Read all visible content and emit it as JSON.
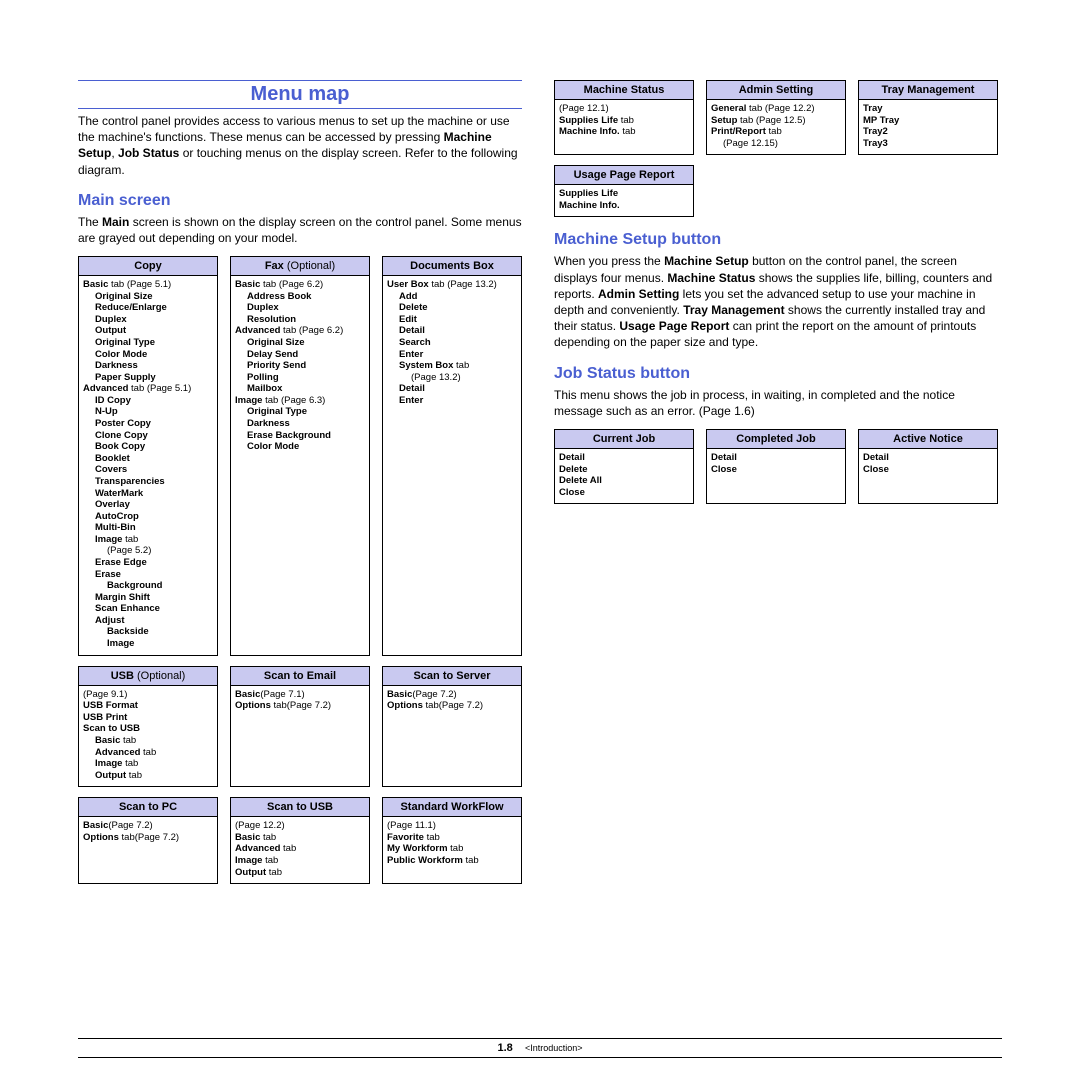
{
  "title": "Menu map",
  "intro": "The control panel provides access to various menus to set up the machine or use the machine's functions. These menus can be accessed by pressing Machine Setup, Job Status or touching menus on the display screen. Refer to the following diagram.",
  "main_screen_h": "Main screen",
  "main_screen_p": "The Main screen is shown on the display screen on the control panel. Some menus are grayed out depending on your model.",
  "machine_setup_h": "Machine Setup button",
  "machine_setup_p": "When you press the Machine Setup button on the control panel, the screen displays four menus. Machine Status shows the supplies life, billing, counters and reports. Admin Setting lets you set the advanced setup to use your machine in depth and conveniently. Tray Management shows the currently installed tray and their status. Usage Page Report can print the report on the amount of printouts depending on the paper size and type.",
  "job_status_h": "Job Status button",
  "job_status_p": "This menu shows the job in process, in waiting, in completed and the notice message such as an error. (Page 1.6)",
  "footer_page": "1.8",
  "footer_section": "<Introduction>",
  "left_row1": {
    "copy": {
      "title": "Copy",
      "lines": [
        {
          "t": "Basic",
          "b": 1,
          "a": " tab (Page 5.1)"
        },
        {
          "t": "Original Size",
          "b": 1,
          "ind": 1
        },
        {
          "t": "Reduce/Enlarge",
          "b": 1,
          "ind": 1
        },
        {
          "t": "Duplex",
          "b": 1,
          "ind": 1
        },
        {
          "t": "Output",
          "b": 1,
          "ind": 1
        },
        {
          "t": "Original Type",
          "b": 1,
          "ind": 1
        },
        {
          "t": "Color Mode",
          "b": 1,
          "ind": 1
        },
        {
          "t": "Darkness",
          "b": 1,
          "ind": 1
        },
        {
          "t": "Paper Supply",
          "b": 1,
          "ind": 1
        },
        {
          "t": "Advanced",
          "b": 1,
          "a": " tab (Page 5.1)"
        },
        {
          "t": "ID Copy",
          "b": 1,
          "ind": 1
        },
        {
          "t": "N-Up",
          "b": 1,
          "ind": 1
        },
        {
          "t": "Poster Copy",
          "b": 1,
          "ind": 1
        },
        {
          "t": "Clone Copy",
          "b": 1,
          "ind": 1
        },
        {
          "t": "Book Copy",
          "b": 1,
          "ind": 1
        },
        {
          "t": "Booklet",
          "b": 1,
          "ind": 1
        },
        {
          "t": "Covers",
          "b": 1,
          "ind": 1
        },
        {
          "t": "Transparencies",
          "b": 1,
          "ind": 1
        },
        {
          "t": "WaterMark",
          "b": 1,
          "ind": 1
        },
        {
          "t": "Overlay",
          "b": 1,
          "ind": 1
        },
        {
          "t": "AutoCrop",
          "b": 1,
          "ind": 1
        },
        {
          "t": "Multi-Bin",
          "b": 1,
          "ind": 1
        },
        {
          "t": "Image",
          "b": 1,
          "ind": 1,
          "a": " tab"
        },
        {
          "t": "(Page 5.2)",
          "b": 0,
          "ind": 2
        },
        {
          "t": "Erase Edge",
          "b": 1,
          "ind": 1
        },
        {
          "t": "Erase",
          "b": 1,
          "ind": 1
        },
        {
          "t": "Background",
          "b": 1,
          "ind": 2
        },
        {
          "t": "Margin Shift",
          "b": 1,
          "ind": 1
        },
        {
          "t": "Scan Enhance",
          "b": 1,
          "ind": 1
        },
        {
          "t": "Adjust",
          "b": 1,
          "ind": 1
        },
        {
          "t": "Backside",
          "b": 1,
          "ind": 2
        },
        {
          "t": "Image",
          "b": 1,
          "ind": 2
        }
      ]
    },
    "fax": {
      "title": "Fax",
      "opt": " (Optional)",
      "lines": [
        {
          "t": "Basic",
          "b": 1,
          "a": " tab (Page 6.2)"
        },
        {
          "t": "Address Book",
          "b": 1,
          "ind": 1
        },
        {
          "t": "Duplex",
          "b": 1,
          "ind": 1
        },
        {
          "t": "Resolution",
          "b": 1,
          "ind": 1
        },
        {
          "t": "Advanced",
          "b": 1,
          "a": " tab (Page 6.2)"
        },
        {
          "t": "Original Size",
          "b": 1,
          "ind": 1
        },
        {
          "t": "Delay Send",
          "b": 1,
          "ind": 1
        },
        {
          "t": "Priority Send",
          "b": 1,
          "ind": 1
        },
        {
          "t": "Polling",
          "b": 1,
          "ind": 1
        },
        {
          "t": "Mailbox",
          "b": 1,
          "ind": 1
        },
        {
          "t": "Image",
          "b": 1,
          "a": " tab (Page 6.3)"
        },
        {
          "t": "Original Type",
          "b": 1,
          "ind": 1
        },
        {
          "t": "Darkness",
          "b": 1,
          "ind": 1
        },
        {
          "t": "Erase Background",
          "b": 1,
          "ind": 1
        },
        {
          "t": "Color Mode",
          "b": 1,
          "ind": 1
        }
      ]
    },
    "docbox": {
      "title": "Documents Box",
      "lines": [
        {
          "t": "User Box",
          "b": 1,
          "a": " tab (Page 13.2)"
        },
        {
          "t": "Add",
          "b": 1,
          "ind": 1
        },
        {
          "t": "Delete",
          "b": 1,
          "ind": 1
        },
        {
          "t": "Edit",
          "b": 1,
          "ind": 1
        },
        {
          "t": "Detail",
          "b": 1,
          "ind": 1
        },
        {
          "t": "Search",
          "b": 1,
          "ind": 1
        },
        {
          "t": "Enter",
          "b": 1,
          "ind": 1
        },
        {
          "t": "System Box",
          "b": 1,
          "ind": 1,
          "a": " tab"
        },
        {
          "t": "(Page 13.2)",
          "b": 0,
          "ind": 2
        },
        {
          "t": "Detail",
          "b": 1,
          "ind": 1
        },
        {
          "t": "Enter",
          "b": 1,
          "ind": 1
        }
      ]
    }
  },
  "left_row2": {
    "usb": {
      "title": "USB",
      "opt": " (Optional)",
      "lines": [
        {
          "t": "(Page 9.1)",
          "b": 0
        },
        {
          "t": "USB Format",
          "b": 1
        },
        {
          "t": "USB Print",
          "b": 1
        },
        {
          "t": "Scan to USB",
          "b": 1
        },
        {
          "t": "Basic",
          "b": 1,
          "ind": 1,
          "a": " tab"
        },
        {
          "t": "Advanced",
          "b": 1,
          "ind": 1,
          "a": " tab"
        },
        {
          "t": "Image",
          "b": 1,
          "ind": 1,
          "a": " tab"
        },
        {
          "t": "Output",
          "b": 1,
          "ind": 1,
          "a": " tab"
        }
      ]
    },
    "scan_email": {
      "title": "Scan to Email",
      "lines": [
        {
          "t": "Basic",
          "b": 1,
          "a": "(Page 7.1)"
        },
        {
          "t": "Options",
          "b": 1,
          "a": " tab(Page 7.2)"
        }
      ]
    },
    "scan_server": {
      "title": "Scan to Server",
      "lines": [
        {
          "t": "Basic",
          "b": 1,
          "a": "(Page 7.2)"
        },
        {
          "t": "Options",
          "b": 1,
          "a": " tab(Page 7.2)"
        }
      ]
    }
  },
  "left_row3": {
    "scan_pc": {
      "title": "Scan to PC",
      "lines": [
        {
          "t": "Basic",
          "b": 1,
          "a": "(Page 7.2)"
        },
        {
          "t": "Options",
          "b": 1,
          "a": " tab(Page 7.2)"
        }
      ]
    },
    "scan_usb": {
      "title": "Scan to USB",
      "lines": [
        {
          "t": "(Page 12.2)",
          "b": 0
        },
        {
          "t": "Basic",
          "b": 1,
          "a": " tab"
        },
        {
          "t": "Advanced",
          "b": 1,
          "a": " tab"
        },
        {
          "t": "Image",
          "b": 1,
          "a": " tab"
        },
        {
          "t": "Output",
          "b": 1,
          "a": " tab"
        }
      ]
    },
    "workflow": {
      "title": "Standard WorkFlow",
      "lines": [
        {
          "t": "(Page 11.1)",
          "b": 0
        },
        {
          "t": "Favorite",
          "b": 1,
          "a": " tab"
        },
        {
          "t": "My Workform",
          "b": 1,
          "a": " tab"
        },
        {
          "t": "Public Workform",
          "b": 1,
          "a": " tab"
        }
      ]
    }
  },
  "right_row1": {
    "machine_status": {
      "title": "Machine Status",
      "lines": [
        {
          "t": "(Page 12.1)",
          "b": 0
        },
        {
          "t": "Supplies Life",
          "b": 1,
          "a": " tab"
        },
        {
          "t": "Machine Info.",
          "b": 1,
          "a": " tab"
        }
      ]
    },
    "admin_setting": {
      "title": "Admin Setting",
      "lines": [
        {
          "t": "General",
          "b": 1,
          "a": " tab (Page 12.2)"
        },
        {
          "t": "Setup",
          "b": 1,
          "a": " tab (Page 12.5)"
        },
        {
          "t": "Print/Report",
          "b": 1,
          "a": " tab"
        },
        {
          "t": "(Page 12.15)",
          "b": 0,
          "ind": 1
        }
      ]
    },
    "tray_mgmt": {
      "title": "Tray Management",
      "lines": [
        {
          "t": "Tray",
          "b": 1
        },
        {
          "t": "MP Tray",
          "b": 1
        },
        {
          "t": "Tray2",
          "b": 1
        },
        {
          "t": "Tray3",
          "b": 1
        }
      ]
    }
  },
  "right_row1b": {
    "usage_report": {
      "title": "Usage Page Report",
      "lines": [
        {
          "t": "Supplies Life",
          "b": 1
        },
        {
          "t": "Machine Info.",
          "b": 1
        }
      ]
    }
  },
  "right_row2": {
    "current_job": {
      "title": "Current Job",
      "lines": [
        {
          "t": "Detail",
          "b": 1
        },
        {
          "t": "Delete",
          "b": 1
        },
        {
          "t": "Delete All",
          "b": 1
        },
        {
          "t": "Close",
          "b": 1
        }
      ]
    },
    "completed_job": {
      "title": "Completed Job",
      "lines": [
        {
          "t": "Detail",
          "b": 1
        },
        {
          "t": "Close",
          "b": 1
        }
      ]
    },
    "active_notice": {
      "title": "Active Notice",
      "lines": [
        {
          "t": "Detail",
          "b": 1
        },
        {
          "t": "Close",
          "b": 1
        }
      ]
    }
  }
}
